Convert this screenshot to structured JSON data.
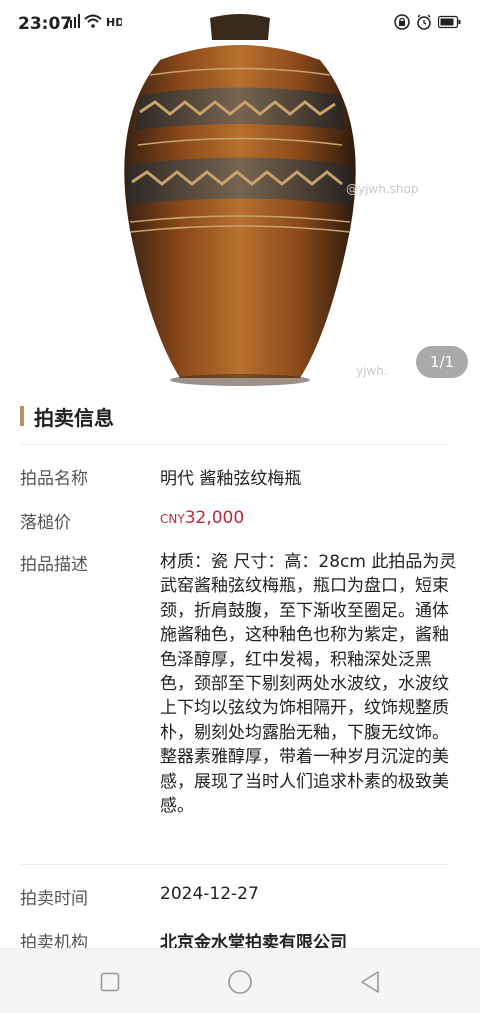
{
  "status": {
    "time": "23:07",
    "icons_left": [
      "signal-icon",
      "wifi-icon",
      "hd-icon"
    ],
    "icons_right": [
      "lock-icon",
      "alarm-icon",
      "battery-icon"
    ]
  },
  "image": {
    "counter": "1/1",
    "watermark_1": "@yjwh.shop",
    "watermark_2": "yjwh."
  },
  "section": {
    "title": "拍卖信息"
  },
  "details": {
    "name_label": "拍品名称",
    "name_value": "明代 酱釉弦纹梅瓶",
    "price_label": "落槌价",
    "price_currency": "CNY",
    "price_amount": "32,000",
    "desc_label": "拍品描述",
    "desc_value": "材质：瓷 尺寸：高：28cm 此拍品为灵武窑酱釉弦纹梅瓶，瓶口为盘口，短束颈，折肩鼓腹，至下渐收至圈足。通体施酱釉色，这种釉色也称为紫定，酱釉色泽醇厚，红中发褐，积釉深处泛黑色，颈部至下剔刻两处水波纹，水波纹上下均以弦纹为饰相隔开，纹饰规整质朴，剔刻处均露胎无釉，下腹无纹饰。整器素雅醇厚，带着一种岁月沉淀的美感，展现了当时人们追求朴素的极致美感。",
    "date_label": "拍卖时间",
    "date_value": "2024-12-27",
    "house_label": "拍卖机构",
    "house_value": "北京金水堂拍卖有限公司"
  },
  "colors": {
    "accent": "#b8925a",
    "price": "#c0283a"
  }
}
